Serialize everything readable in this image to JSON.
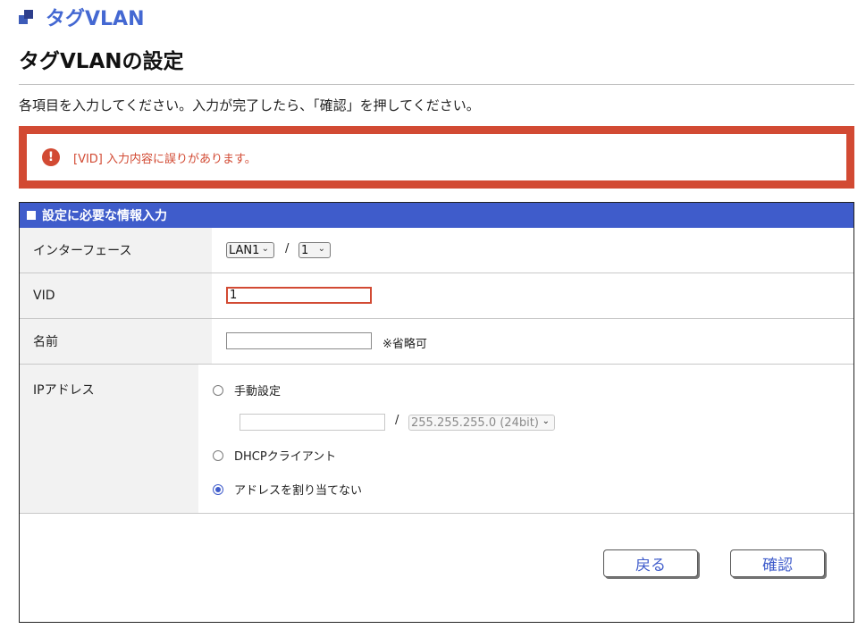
{
  "breadcrumb": {
    "title": "タグVLAN"
  },
  "page": {
    "title": "タグVLANの設定",
    "instruction": "各項目を入力してください。入力が完了したら、「確認」を押してください。"
  },
  "error": {
    "icon": "exclamation-circle-icon",
    "message": "[VID] 入力内容に誤りがあります。"
  },
  "panel": {
    "header": "設定に必要な情報入力",
    "rows": {
      "interface": {
        "label": "インターフェース",
        "port": "LAN1",
        "separator": "/",
        "index": "1"
      },
      "vid": {
        "label": "VID",
        "value": "1"
      },
      "name": {
        "label": "名前",
        "value": "",
        "note": "※省略可"
      },
      "ip": {
        "label": "IPアドレス",
        "manual_label": "手動設定",
        "address_value": "",
        "separator": "/",
        "mask": "255.255.255.0 (24bit)",
        "dhcp_label": "DHCPクライアント",
        "none_label": "アドレスを割り当てない",
        "selected": "none"
      }
    }
  },
  "buttons": {
    "back": "戻る",
    "confirm": "確認"
  },
  "colors": {
    "accent": "#3f5ccb",
    "link": "#4468d2",
    "error": "#d24a33"
  }
}
